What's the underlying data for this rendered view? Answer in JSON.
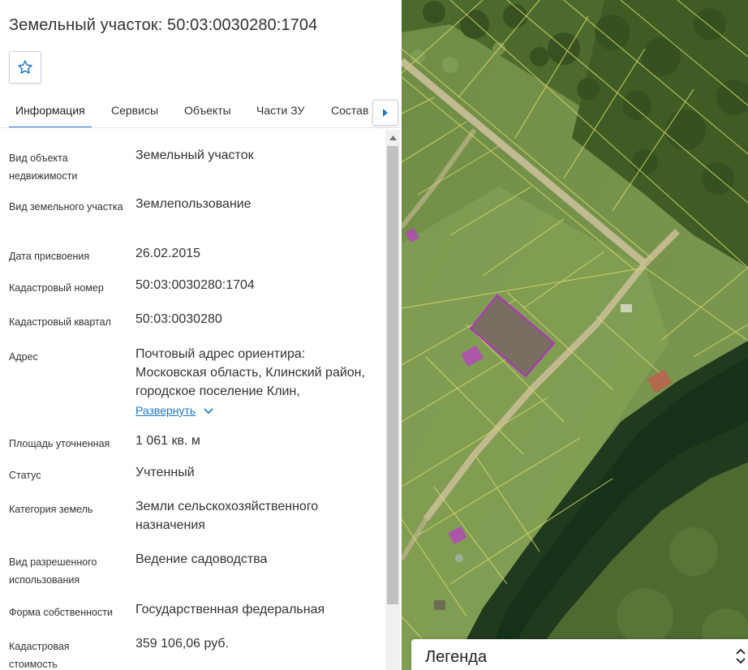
{
  "header": {
    "title": "Земельный участок: 50:03:0030280:1704"
  },
  "tabs": [
    {
      "label": "Информация",
      "active": true
    },
    {
      "label": "Сервисы"
    },
    {
      "label": "Объекты"
    },
    {
      "label": "Части ЗУ"
    },
    {
      "label": "Состав"
    }
  ],
  "info": [
    {
      "label": "Вид объекта недвижимости",
      "value": "Земельный участок"
    },
    {
      "label": "Вид земельного участка",
      "value": "Землепользование"
    },
    {
      "label": "Дата присвоения",
      "value": "26.02.2015"
    },
    {
      "label": "Кадастровый номер",
      "value": "50:03:0030280:1704"
    },
    {
      "label": "Кадастровый квартал",
      "value": "50:03:0030280"
    },
    {
      "label": "Адрес",
      "value": "Почтовый адрес ориентира: Московская область, Клинский район, городское поселение Клин,",
      "expand_label": "Развернуть"
    },
    {
      "label": "Площадь уточненная",
      "value": "1 061 кв. м"
    },
    {
      "label": "Статус",
      "value": "Учтенный"
    },
    {
      "label": "Категория земель",
      "value": "Земли сельскохозяйственного назначения"
    },
    {
      "label": "Вид разрешенного использования",
      "value": "Ведение садоводства"
    },
    {
      "label": "Форма собственности",
      "value": "Государственная федеральная"
    },
    {
      "label": "Кадастровая стоимость",
      "value": "359 106,06 руб."
    }
  ],
  "legend": {
    "label": "Легенда"
  },
  "colors": {
    "accent": "#1f7ac2",
    "parcel_outline": "#d8d86a",
    "selected_parcel": "#b030c0"
  }
}
